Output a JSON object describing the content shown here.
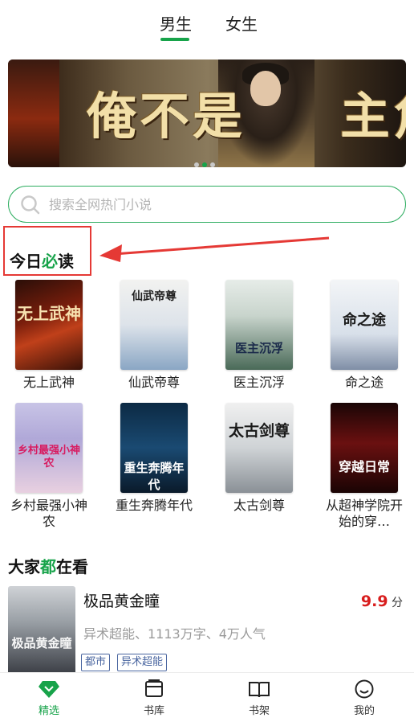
{
  "top_tabs": {
    "boys": "男生",
    "girls": "女生",
    "active": "boys"
  },
  "banner": {
    "title_left": "俺不是",
    "title_right": "主角",
    "active_dot": 1
  },
  "search": {
    "placeholder": "搜索全网热门小说"
  },
  "today": {
    "title_a": "今日",
    "title_accent": "必",
    "title_b": "读",
    "books": [
      {
        "name": "无上武神",
        "cover_text": "无上武神"
      },
      {
        "name": "仙武帝尊",
        "cover_text": "仙武帝尊"
      },
      {
        "name": "医主沉浮",
        "cover_text": "医主沉浮"
      },
      {
        "name": "命之途",
        "cover_text": "命之途"
      },
      {
        "name": "乡村最强小神农",
        "cover_text": "乡村最强小神农"
      },
      {
        "name": "重生奔腾年代",
        "cover_text": "重生奔腾年代"
      },
      {
        "name": "太古剑尊",
        "cover_text": "太古剑尊"
      },
      {
        "name": "从超神学院开始的穿…",
        "cover_text": "穿越日常"
      }
    ]
  },
  "everyone": {
    "title_a": "大家",
    "title_accent": "都",
    "title_b": "在看",
    "feature": {
      "title": "极品黄金瞳",
      "score": "9.9",
      "score_unit": "分",
      "meta": "异术超能、1113万字、4万人气",
      "tags": [
        "都市",
        "异术超能"
      ],
      "cover_text": "极品黄金瞳"
    }
  },
  "bottom_nav": [
    {
      "label": "精选",
      "icon": "diamond-icon",
      "active": true
    },
    {
      "label": "书库",
      "icon": "library-icon",
      "active": false
    },
    {
      "label": "书架",
      "icon": "bookshelf-icon",
      "active": false
    },
    {
      "label": "我的",
      "icon": "profile-icon",
      "active": false
    }
  ],
  "colors": {
    "accent": "#17a34a",
    "highlight": "#e53935",
    "score": "#d81d1d",
    "tag": "#4a66a0"
  }
}
